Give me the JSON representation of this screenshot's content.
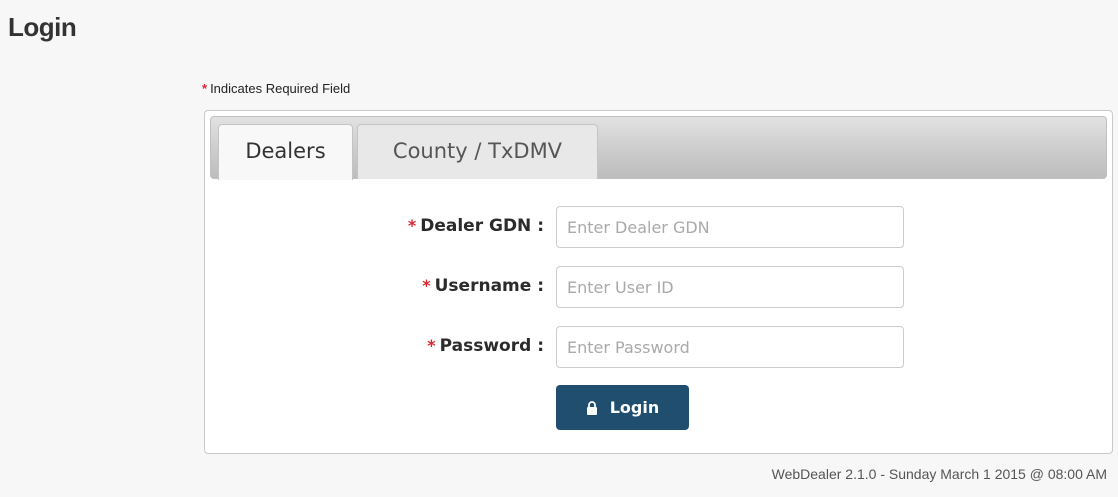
{
  "page": {
    "title": "Login"
  },
  "required_note": {
    "marker": "*",
    "text": "Indicates Required Field"
  },
  "tabs": [
    {
      "label": "Dealers",
      "active": true
    },
    {
      "label": "County / TxDMV",
      "active": false
    }
  ],
  "form": {
    "fields": [
      {
        "label": "Dealer GDN :",
        "placeholder": "Enter Dealer GDN",
        "value": "",
        "required": true
      },
      {
        "label": "Username :",
        "placeholder": "Enter User ID",
        "value": "",
        "required": true
      },
      {
        "label": "Password :",
        "placeholder": "Enter Password",
        "value": "",
        "required": true
      }
    ],
    "submit_label": "Login",
    "submit_icon": "lock-icon"
  },
  "footer": {
    "version_text": "WebDealer 2.1.0 - Sunday March 1 2015 @ 08:00 AM"
  },
  "colors": {
    "required_star": "#d9262e",
    "button_bg": "#1f4e6e",
    "page_bg": "#f7f7f7"
  }
}
